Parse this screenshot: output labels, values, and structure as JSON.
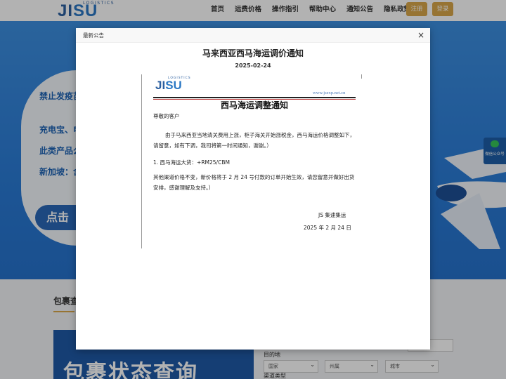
{
  "header": {
    "logo": {
      "sub": "LOGISTICS",
      "main_a": "JI",
      "main_b": "SU"
    },
    "nav": [
      "首页",
      "运费价格",
      "操作指引",
      "帮助中心",
      "通知公告",
      "隐私政策"
    ],
    "register_label": "注册",
    "login_label": "登录"
  },
  "background": {
    "hero_lines": [
      "禁止发疫苗",
      "充电宝、电",
      "此类产品么",
      "新加坡：含"
    ],
    "hero_button": "点击",
    "wechat_label": "微信公众号",
    "package_title": "包裹查",
    "banner_text": "包裹状态查询",
    "form": {
      "destination_label": "目的地",
      "selects": [
        "国家",
        "州属",
        "城市"
      ],
      "channel_label": "渠道类型"
    }
  },
  "modal": {
    "header_title": "最新公告",
    "close_label": "×",
    "title": "马来西亚西马海运调价通知",
    "date": "2025-02-24",
    "document": {
      "logo": {
        "sub": "LOGISTICS",
        "main_a": "JI",
        "main_b": "SU"
      },
      "url": "www.jsexp.net.cn",
      "heading": "西马海运调整通知",
      "greeting": "尊敬的客户",
      "paragraph1": "由于马来西亚当地清关费用上涨，柜子海关开始涨税金，西马海运价格调整如下，请留意，如有下调，我司将第一时间通知，谢谢。）",
      "item1": "1.  西马海运大货：+RM25/CBM",
      "paragraph2": "其他渠道价格不变，新价格将于 2 月 24 号付款的订单开始生效，请您留意并做好出货安排，感谢理解及支持。）",
      "signature": "JS 集速集运",
      "signed_date": "2025 年  2 月  24 日"
    }
  },
  "colors": {
    "brand_blue": "#2b5fa0",
    "hero_blue": "#2a7bd6",
    "accent_gold": "#d8a64a",
    "wechat_green": "#35c35a"
  }
}
